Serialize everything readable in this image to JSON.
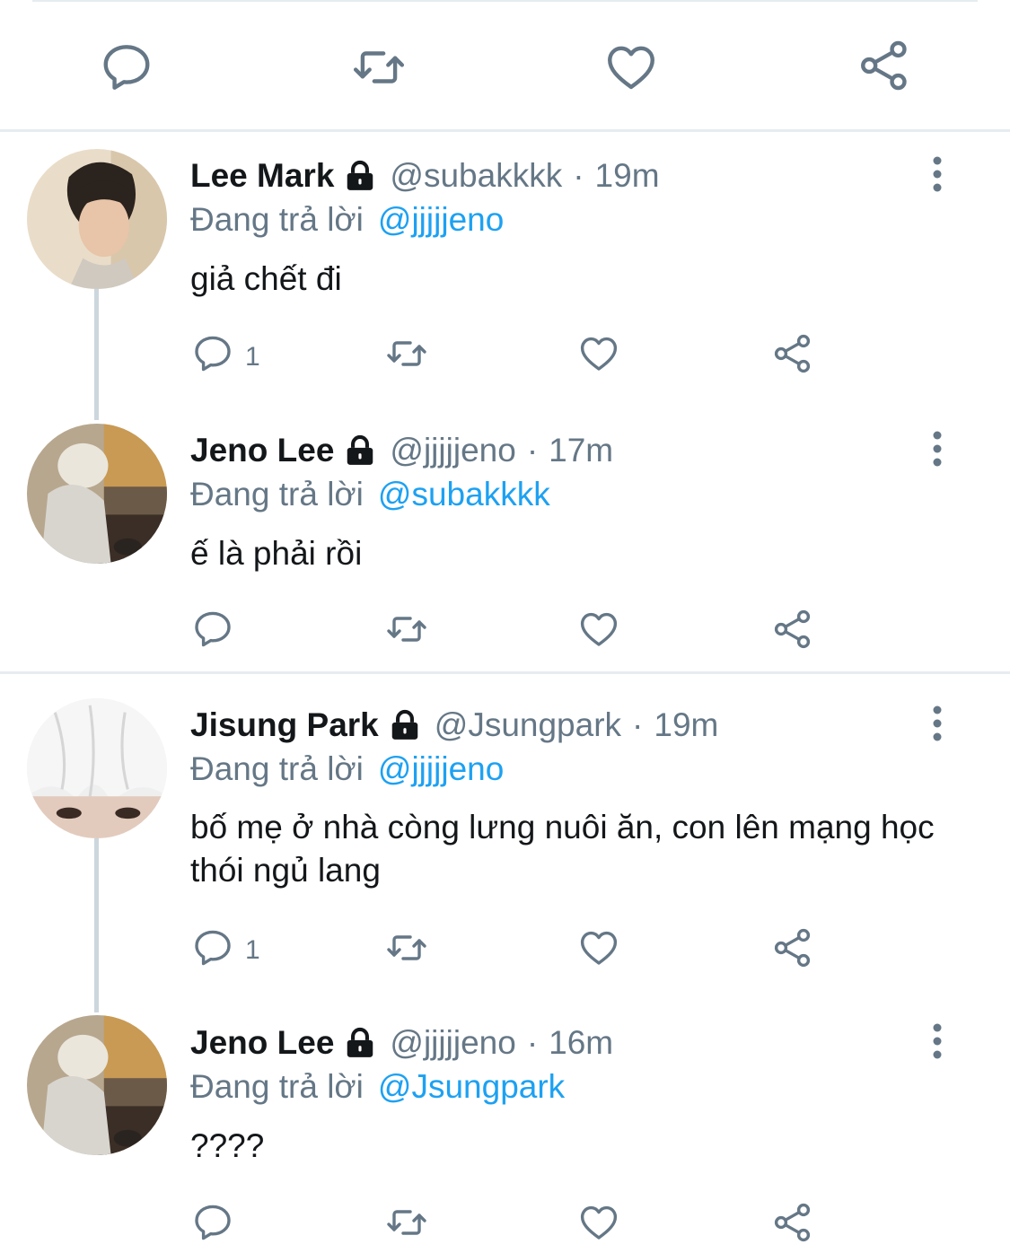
{
  "colors": {
    "text": "#14171a",
    "secondary": "#657786",
    "link": "#1da1f2",
    "divider": "#e6ecf0",
    "thread": "#ccd6dd"
  },
  "top_actions": [
    "comment-icon",
    "retweet-icon",
    "like-icon",
    "share-icon"
  ],
  "tweets": [
    {
      "name": "Lee Mark",
      "handle": "@subakkkk",
      "sep": "·",
      "time": "19m",
      "reply_prefix": "Đang trả lời",
      "reply_to": "@jjjjjeno",
      "text": "giả chết đi",
      "reply_count": "1"
    },
    {
      "name": "Jeno Lee",
      "handle": "@jjjjjeno",
      "sep": "·",
      "time": "17m",
      "reply_prefix": "Đang trả lời",
      "reply_to": "@subakkkk",
      "text": "ế là phải rồi",
      "reply_count": ""
    },
    {
      "name": "Jisung Park",
      "handle": "@Jsungpark",
      "sep": "·",
      "time": "19m",
      "reply_prefix": "Đang trả lời",
      "reply_to": "@jjjjjeno",
      "text": "bố mẹ ở nhà còng lưng nuôi ăn, con lên mạng học thói ngủ lang",
      "reply_count": "1"
    },
    {
      "name": "Jeno Lee",
      "handle": "@jjjjjeno",
      "sep": "·",
      "time": "16m",
      "reply_prefix": "Đang trả lời",
      "reply_to": "@Jsungpark",
      "text": "????",
      "reply_count": ""
    }
  ]
}
